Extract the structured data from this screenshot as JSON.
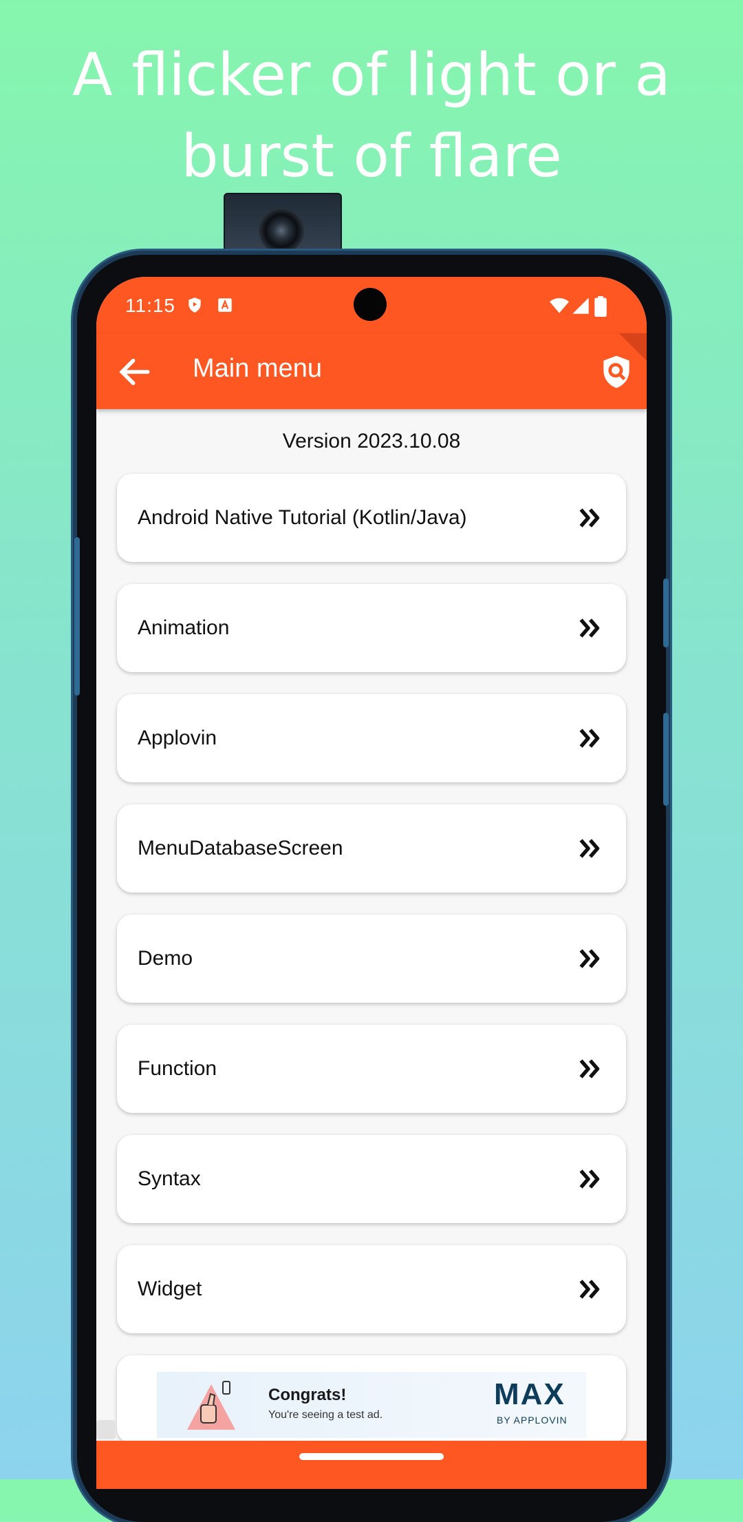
{
  "promo": {
    "headline_line1": "A flicker of light or a",
    "headline_line2": "burst of flare"
  },
  "status_bar": {
    "time": "11:15"
  },
  "app_bar": {
    "title": "Main menu",
    "back_icon": "arrow-left-icon",
    "search_icon": "shield-search-icon"
  },
  "version_text": "Version 2023.10.08",
  "menu_items": [
    "Android Native Tutorial (Kotlin/Java)",
    "Animation",
    "Applovin",
    "MenuDatabaseScreen",
    "Demo",
    "Function",
    "Syntax",
    "Widget"
  ],
  "ad": {
    "congrats": "Congrats!",
    "subtitle": "You're seeing a test ad.",
    "brand": "MAX",
    "brand_by": "BY APPLOVIN"
  },
  "colors": {
    "accent": "#ff5722",
    "background": "#f7f7f7"
  }
}
